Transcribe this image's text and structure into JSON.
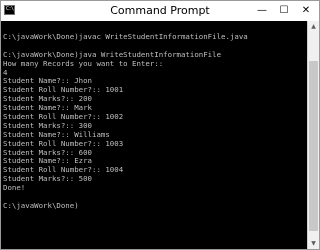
{
  "window": {
    "title": "Command Prompt",
    "icon_text": "C:\\",
    "minimize_glyph": "—",
    "maximize_glyph": "☐",
    "close_glyph": "✕"
  },
  "console": {
    "background": "#000000",
    "text_color": "#c0c0c0",
    "lines": [
      "C:\\javaWork\\Done)javac WriteStudentInformationFile.java",
      "",
      "C:\\javaWork\\Done)java WriteStudentInformationFile",
      "How many Records you want to Enter::",
      "4",
      "Student Name?:: Jhon",
      "Student Roll Number?:: 1001",
      "Student Marks?:: 200",
      "Student Name?:: Mark",
      "Student Roll Number?:: 1002",
      "Student Marks?:: 300",
      "Student Name?:: Williams",
      "Student Roll Number?:: 1003",
      "Student Marks?:: 600",
      "Student Name?:: Ezra",
      "Student Roll Number?:: 1004",
      "Student Marks?:: 500",
      "Done!",
      "",
      "C:\\javaWork\\Done)"
    ]
  },
  "scrollbar": {
    "up_icon": "up-arrow",
    "down_icon": "down-arrow"
  }
}
